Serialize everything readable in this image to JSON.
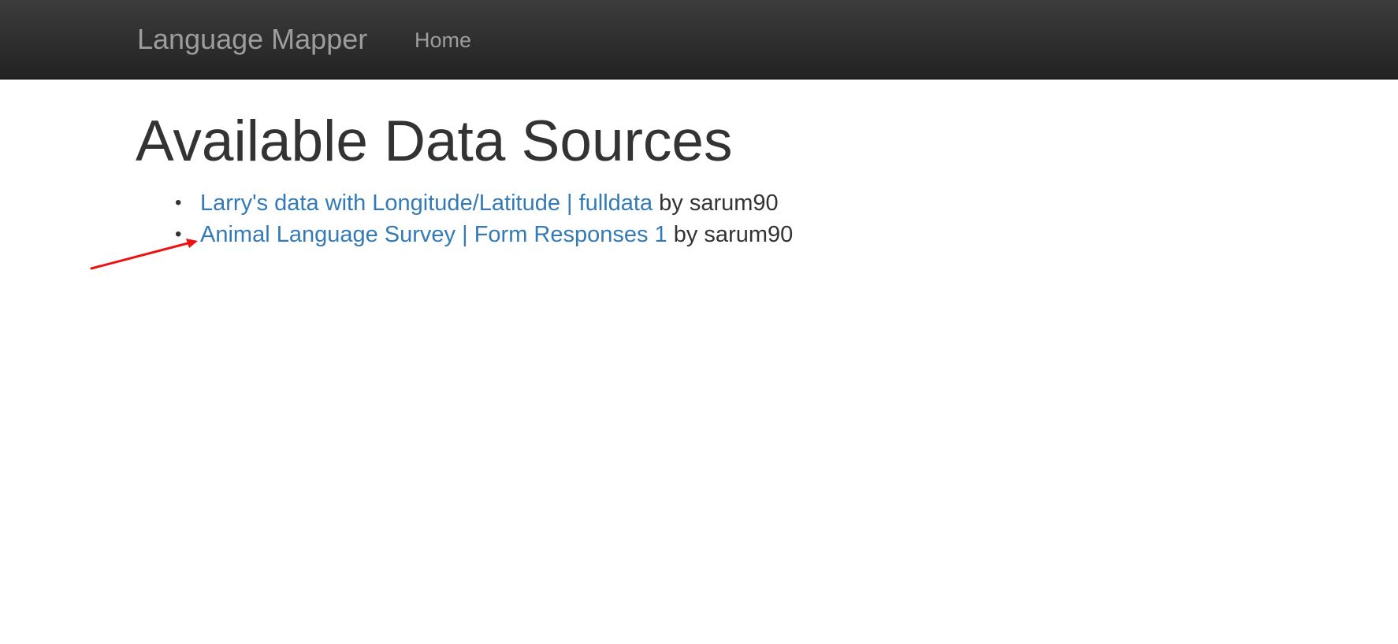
{
  "navbar": {
    "brand": "Language Mapper",
    "home_label": "Home"
  },
  "main": {
    "title": "Available Data Sources",
    "sources": [
      {
        "link_text": "Larry's data with Longitude/Latitude | fulldata",
        "author_text": "by sarum90"
      },
      {
        "link_text": "Animal Language Survey | Form Responses 1",
        "author_text": "by sarum90"
      }
    ]
  },
  "annotation": {
    "type": "arrow",
    "color": "#ee1111",
    "points_to": "list-item-2"
  },
  "colors": {
    "navbar_bg": "#222222",
    "nav_text": "#9d9d9d",
    "link": "#337ab7",
    "body_text": "#333333"
  }
}
